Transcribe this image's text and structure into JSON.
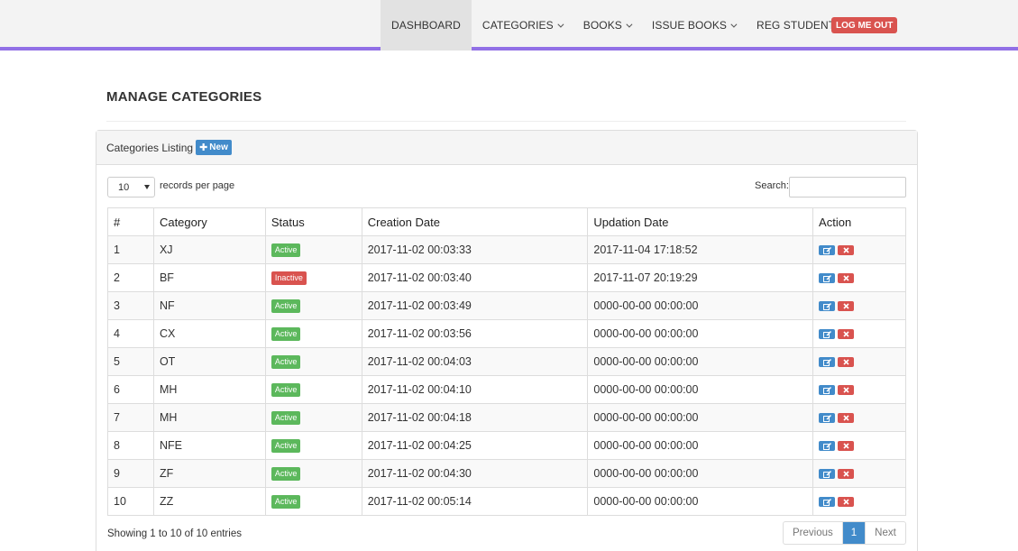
{
  "nav": {
    "dashboard": "DASHBOARD",
    "categories": "CATEGORIES",
    "books": "BOOKS",
    "issue_books": "ISSUE BOOKS",
    "reg_students": "REG STUDENTS",
    "logout": "LOG ME OUT"
  },
  "page": {
    "title": "MANAGE CATEGORIES"
  },
  "panel": {
    "heading": "Categories Listing",
    "new_label": "New",
    "length_value": "10",
    "length_label": "records per page",
    "search_label": "Search:",
    "search_value": ""
  },
  "table": {
    "headers": [
      "#",
      "Category",
      "Status",
      "Creation Date",
      "Updation Date",
      "Action"
    ],
    "rows": [
      [
        "1",
        "XJ",
        "Active",
        "2017-11-02 00:03:33",
        "2017-11-04 17:18:52"
      ],
      [
        "2",
        "BF",
        "Inactive",
        "2017-11-02 00:03:40",
        "2017-11-07 20:19:29"
      ],
      [
        "3",
        "NF",
        "Active",
        "2017-11-02 00:03:49",
        "0000-00-00 00:00:00"
      ],
      [
        "4",
        "CX",
        "Active",
        "2017-11-02 00:03:56",
        "0000-00-00 00:00:00"
      ],
      [
        "5",
        "OT",
        "Active",
        "2017-11-02 00:04:03",
        "0000-00-00 00:00:00"
      ],
      [
        "6",
        "MH",
        "Active",
        "2017-11-02 00:04:10",
        "0000-00-00 00:00:00"
      ],
      [
        "7",
        "MH",
        "Active",
        "2017-11-02 00:04:18",
        "0000-00-00 00:00:00"
      ],
      [
        "8",
        "NFE",
        "Active",
        "2017-11-02 00:04:25",
        "0000-00-00 00:00:00"
      ],
      [
        "9",
        "ZF",
        "Active",
        "2017-11-02 00:04:30",
        "0000-00-00 00:00:00"
      ],
      [
        "10",
        "ZZ",
        "Active",
        "2017-11-02 00:05:14",
        "0000-00-00 00:00:00"
      ]
    ]
  },
  "footer": {
    "info": "Showing 1 to 10 of 10 entries",
    "prev": "Previous",
    "page": "1",
    "next": "Next"
  },
  "colors": {
    "accent": "#9170e6",
    "primary": "#428bca",
    "success": "#5cb85c",
    "danger": "#d9534f"
  },
  "icons": {
    "edit": "edit-icon",
    "delete": "delete-icon",
    "new": "plus-icon"
  }
}
